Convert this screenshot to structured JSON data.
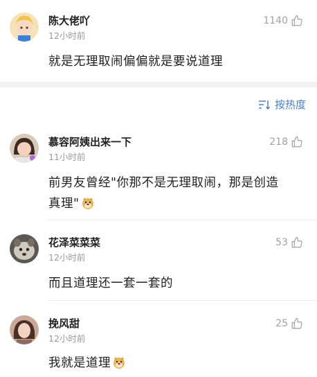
{
  "pinned": {
    "username": "陈大佬吖",
    "time": "12小时前",
    "likes": "1140",
    "text": "就是无理取闹偏偏就是要说道理"
  },
  "sort": {
    "label": "按热度",
    "icon": "sort-icon"
  },
  "comments": [
    {
      "username": "慕容阿姨出来一下",
      "time": "11小时前",
      "likes": "218",
      "text_line1": "前男友曾经\"你那不是无理取闹，那是创造",
      "text_line2": "真理\""
    },
    {
      "username": "花泽菜菜菜",
      "time": "12小时前",
      "likes": "53",
      "text": "而且道理还一套一套的"
    },
    {
      "username": "挽风甜",
      "time": "12小时前",
      "likes": "25",
      "text": "我就是道理"
    }
  ],
  "colors": {
    "accent": "#4a7fbf",
    "muted": "#9a9a9a",
    "text": "#222222"
  }
}
